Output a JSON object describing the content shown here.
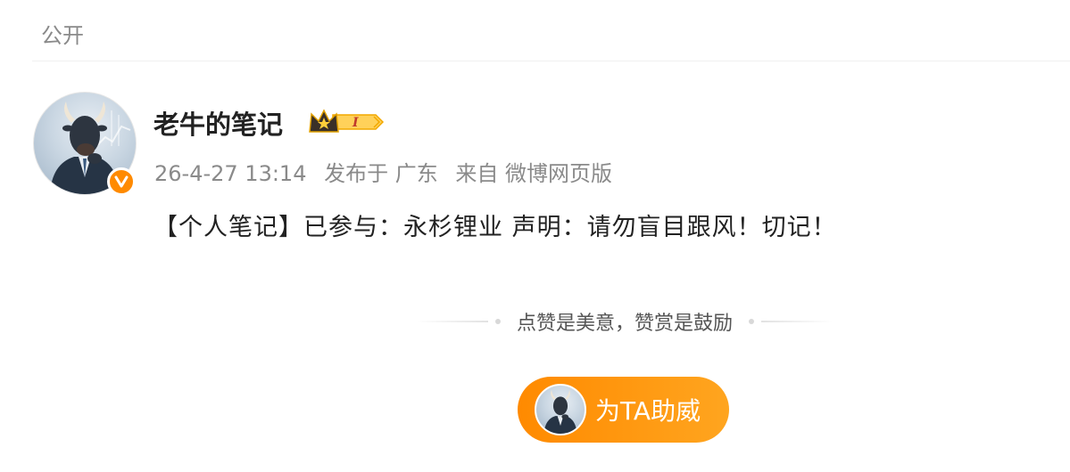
{
  "header": {
    "visibility": "公开"
  },
  "post": {
    "author": {
      "name": "老牛的笔记",
      "vip_level": "I"
    },
    "meta": {
      "time": "26-4-27 13:14",
      "published_in": "发布于 广东",
      "source": "来自 微博网页版"
    },
    "content": "【个人笔记】已参与：永杉锂业  声明：请勿盲目跟风！切记！"
  },
  "tip": {
    "text": "点赞是美意，赞赏是鼓励"
  },
  "support_button": {
    "label": "为TA助威"
  },
  "icons": {
    "avatar": "bull-businessman-avatar",
    "verify": "verified-v-icon",
    "vip": "crown-vip-badge-icon"
  },
  "colors": {
    "accent": "#ff8a00",
    "text": "#222222",
    "muted": "#8a8a8a"
  }
}
